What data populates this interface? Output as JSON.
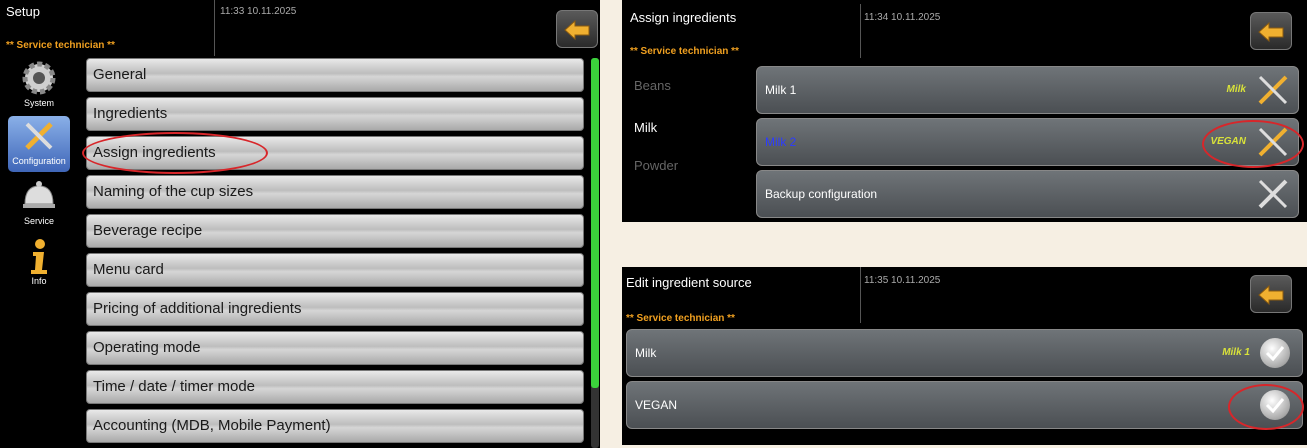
{
  "colors": {
    "accent_orange": "#f0a020",
    "green_scroll": "#3bd23b",
    "annotation_red": "#d8262a"
  },
  "screen1": {
    "title": "Setup",
    "time": "11:33 10.11.2025",
    "role": "** Service technician **",
    "sidebar": [
      {
        "label": "System",
        "icon": "gear-icon"
      },
      {
        "label": "Configuration",
        "icon": "tools-icon",
        "active": true
      },
      {
        "label": "Service",
        "icon": "bell-icon"
      },
      {
        "label": "Info",
        "icon": "info-icon"
      }
    ],
    "menu": [
      "General",
      "Ingredients",
      "Assign ingredients",
      "Naming of the cup sizes",
      "Beverage recipe",
      "Menu card",
      "Pricing of additional ingredients",
      "Operating mode",
      "Time / date / timer mode",
      "Accounting (MDB, Mobile Payment)"
    ]
  },
  "screen2": {
    "title": "Assign ingredients",
    "time": "11:34 10.11.2025",
    "role": "** Service technician **",
    "categories": [
      "Beans",
      "Milk",
      "Powder"
    ],
    "rows": [
      {
        "label": "Milk 1",
        "tag": "Milk"
      },
      {
        "label": "Milk 2",
        "tag": "VEGAN"
      },
      {
        "label": "Backup configuration",
        "tag": ""
      }
    ]
  },
  "screen3": {
    "title": "Edit ingredient source",
    "time": "11:35 10.11.2025",
    "role": "** Service technician **",
    "rows": [
      {
        "label": "Milk",
        "tag": "Milk 1"
      },
      {
        "label": "VEGAN",
        "tag": ""
      }
    ]
  }
}
